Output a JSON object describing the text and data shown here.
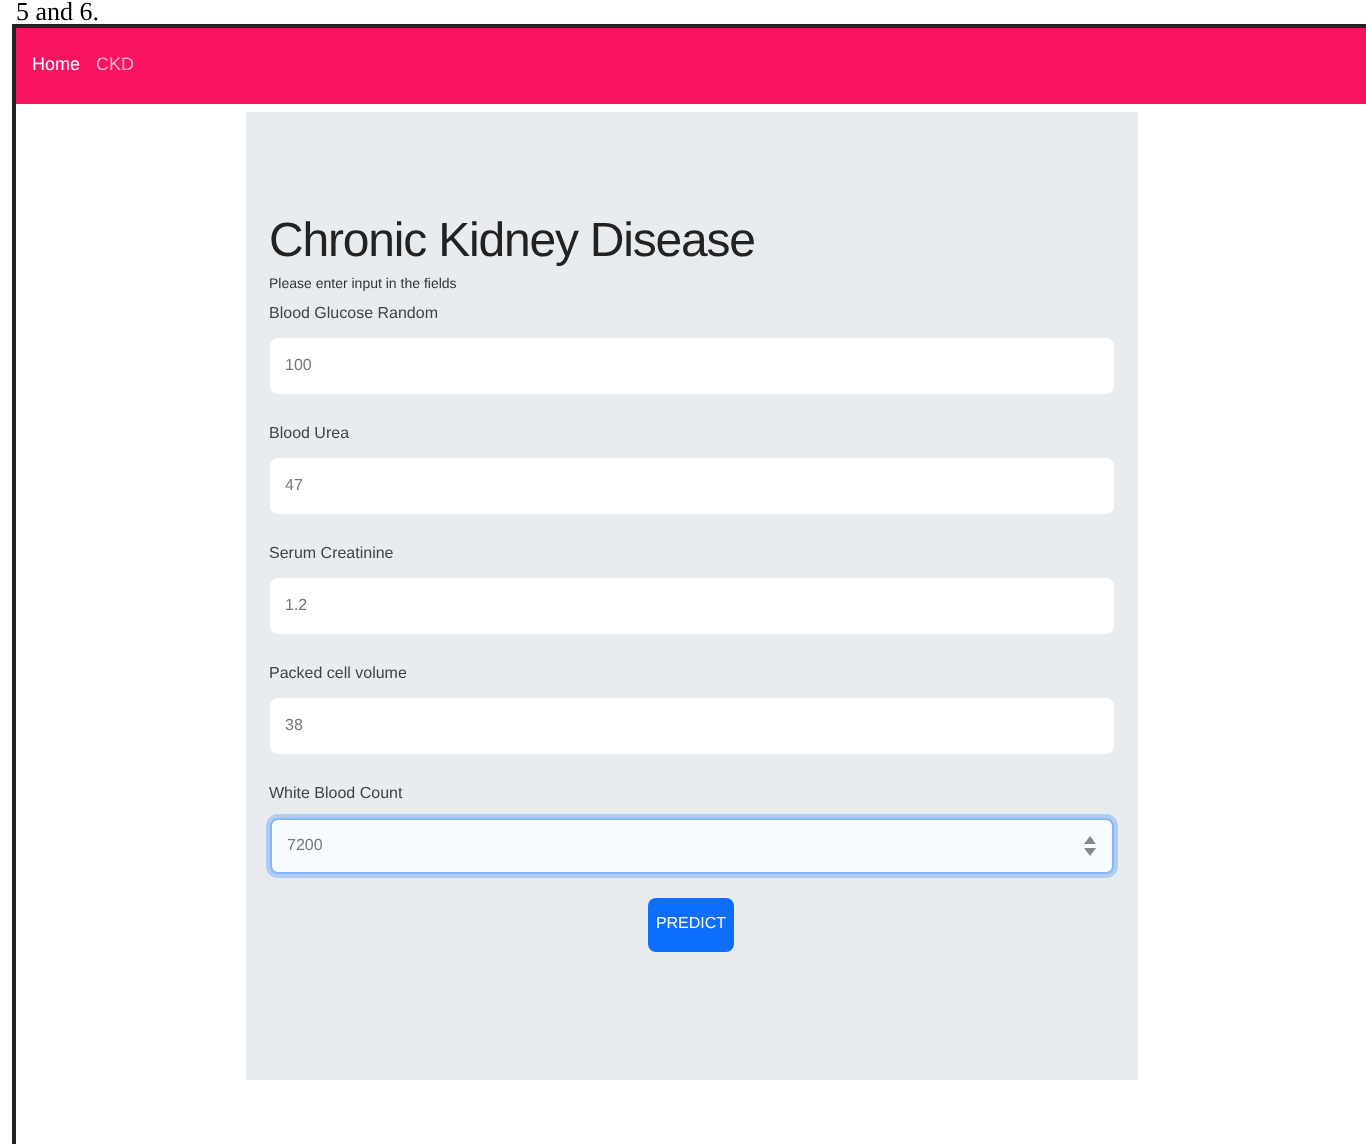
{
  "caption": "5 and 6.",
  "navbar": {
    "links": [
      "Home",
      "CKD"
    ]
  },
  "form": {
    "title": "Chronic Kidney Disease",
    "instruction": "Please enter input in the fields",
    "fields": [
      {
        "label": "Blood Glucose Random",
        "value": "100",
        "focused": false
      },
      {
        "label": "Blood Urea",
        "value": "47",
        "focused": false
      },
      {
        "label": "Serum Creatinine",
        "value": "1.2",
        "focused": false
      },
      {
        "label": "Packed cell volume",
        "value": "38",
        "focused": false
      },
      {
        "label": "White Blood Count",
        "value": "7200",
        "focused": true
      }
    ],
    "button": "PREDICT"
  }
}
